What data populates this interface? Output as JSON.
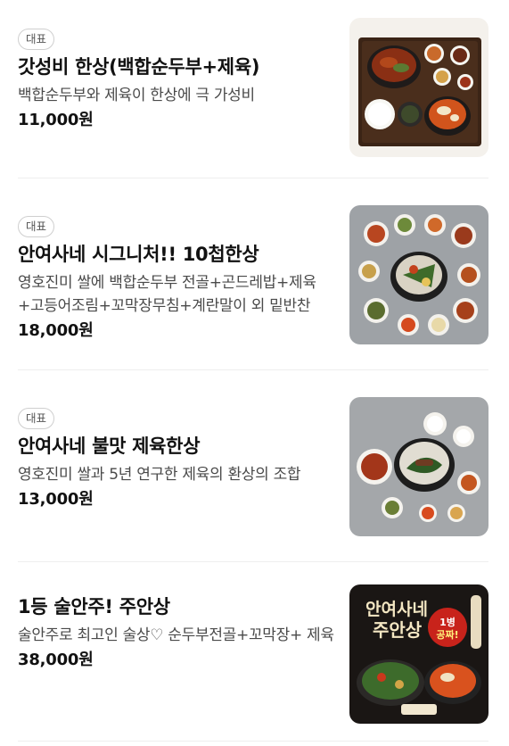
{
  "menu": {
    "items": [
      {
        "badge": "대표",
        "title": "갓성비 한상(백합순두부+제육)",
        "description": "백합순두부와 제육이 한상에 극 가성비",
        "price": "11,000원",
        "image": "meal-tray-photo"
      },
      {
        "badge": "대표",
        "title": "안여사네 시그니처!! 10첩한상",
        "description": "영호진미 쌀에 백합순두부 전골+곤드레밥+제육+고등어조림+꼬막장무침+계란말이 외 밑반찬",
        "price": "18,000원",
        "image": "ten-side-dish-spread-photo"
      },
      {
        "badge": "대표",
        "title": "안여사네 불맛 제육한상",
        "description": "영호진미 쌀과 5년 연구한 제육의 환상의 조합",
        "price": "13,000원",
        "image": "spicy-pork-table-photo"
      },
      {
        "title": "1등 술안주! 주안상",
        "description": "술안주로 최고인 술상♡ 순두부전골+꼬막장+ 제육",
        "price": "38,000원",
        "image": "juansang-poster-photo",
        "poster": {
          "brand": "안여사네",
          "headline": "주안상",
          "sticker_top": "1병",
          "sticker_bottom": "공짜!"
        }
      }
    ]
  },
  "colors": {
    "badge_border": "#cfcfcf",
    "divider": "#eeeeee",
    "price": "#111111"
  }
}
